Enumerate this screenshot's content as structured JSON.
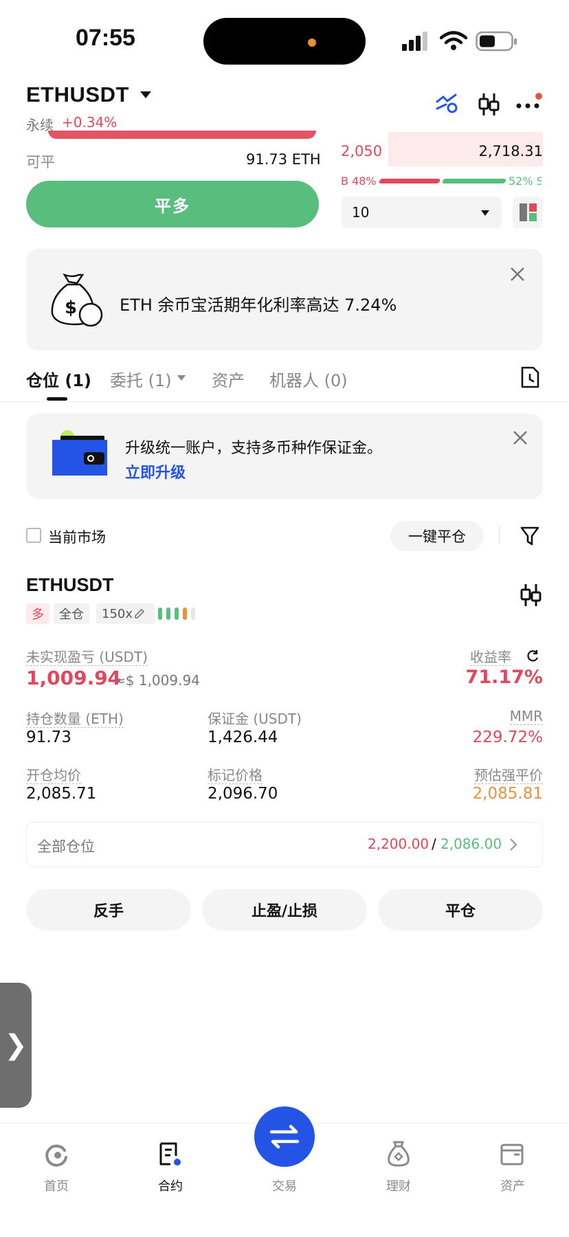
{
  "status": {
    "time": "07:55"
  },
  "header": {
    "symbol": "ETHUSDT",
    "type": "永续",
    "change": "+0.34%",
    "icons": [
      "chart-icon",
      "candles-icon",
      "more-icon"
    ]
  },
  "trade": {
    "available_label": "可平",
    "available_value": "91.73 ETH",
    "close_long_label": "平多",
    "orderbook_price": "2,050",
    "orderbook_qty": "2,718.31",
    "buy_ratio": "B 48%",
    "sell_ratio": "52% S",
    "depth_select": "10"
  },
  "promo": {
    "text": "ETH 余币宝活期年化利率高达 7.24%"
  },
  "tabs": [
    {
      "label": "仓位 (1)"
    },
    {
      "label": "委托 (1)"
    },
    {
      "label": "资产"
    },
    {
      "label": "机器人 (0)"
    }
  ],
  "upgrade": {
    "text": "升级统一账户，支持多币种作保证金。",
    "link": "立即升级"
  },
  "filter": {
    "current_market": "当前市场",
    "close_all": "一键平仓"
  },
  "position": {
    "symbol": "ETHUSDT",
    "side": "多",
    "margin_mode": "全仓",
    "leverage": "150x",
    "pnl_label": "未实现盈亏 (USDT)",
    "pnl_value": "1,009.94",
    "pnl_usd": "≈$ 1,009.94",
    "roe_label": "收益率",
    "roe_value": "71.17%",
    "qty_label": "持仓数量 (ETH)",
    "qty_value": "91.73",
    "margin_label": "保证金 (USDT)",
    "margin_value": "1,426.44",
    "mmr_label": "MMR",
    "mmr_value": "229.72%",
    "entry_label": "开仓均价",
    "entry_value": "2,085.71",
    "mark_label": "标记价格",
    "mark_value": "2,096.70",
    "liq_label": "预估强平价",
    "liq_value": "2,085.81",
    "all_positions_label": "全部仓位",
    "tp_value": "2,200.00",
    "sl_value": "2,086.00",
    "separator": "/"
  },
  "actions": {
    "reverse": "反手",
    "tpsl": "止盈/止损",
    "close": "平仓"
  },
  "nav": [
    {
      "label": "首页"
    },
    {
      "label": "合约"
    },
    {
      "label": "交易"
    },
    {
      "label": "理财"
    },
    {
      "label": "资产"
    }
  ],
  "colors": {
    "red": "#e2475c",
    "green": "#58bd7d",
    "orange": "#f0913a",
    "blue": "#2354e6"
  }
}
